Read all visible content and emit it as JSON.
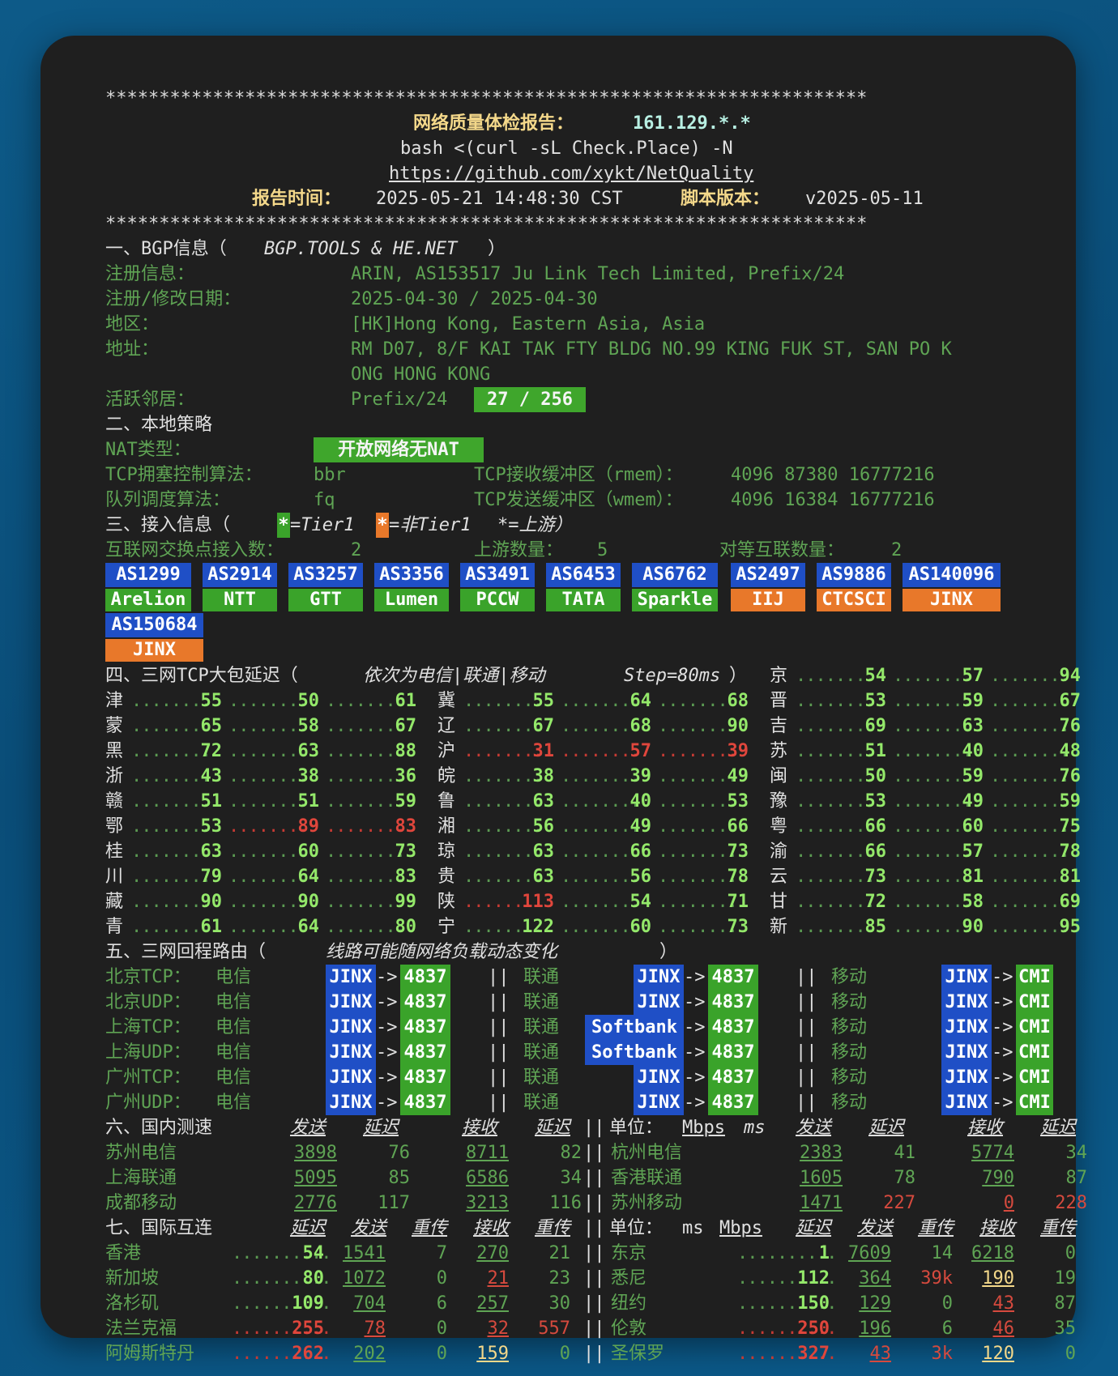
{
  "stars": "***********************************************************************",
  "header": {
    "title": "网络质量体检报告：",
    "ip": "161.129.*.*",
    "cmd": "bash <(curl -sL Check.Place) -N",
    "url": "https://github.com/xykt/NetQuality",
    "time_label": "报告时间：",
    "time_value": "2025-05-21 14:48:30 CST",
    "ver_label": "脚本版本：",
    "ver_value": "v2025-05-11"
  },
  "bgp": {
    "section": "一、BGP信息（",
    "section_src": "BGP.TOOLS & HE.NET",
    "section_end": "）",
    "reg_label": "注册信息：",
    "reg_value": "ARIN, AS153517 Ju Link Tech Limited, Prefix/24",
    "date_label": "注册/修改日期：",
    "date_value": "2025-04-30 / 2025-04-30",
    "region_label": "地区：",
    "region_value": "[HK]Hong Kong, Eastern Asia, Asia",
    "addr_label": "地址：",
    "addr_value1": "RM D07, 8/F KAI TAK FTY BLDG NO.99 KING FUK ST, SAN PO K",
    "addr_value2": "ONG HONG KONG",
    "neigh_label": "活跃邻居：",
    "neigh_prefix": "Prefix/24",
    "neigh_value": "27 / 256"
  },
  "policy": {
    "section": "二、本地策略",
    "nat_label": "NAT类型：",
    "nat_value": "开放网络无NAT",
    "tcp_cc_label": "TCP拥塞控制算法：",
    "tcp_cc_value": "bbr",
    "rmem_label": "TCP接收缓冲区（rmem）：",
    "rmem_value": "4096 87380 16777216",
    "qdisc_label": "队列调度算法：",
    "qdisc_value": "fq",
    "wmem_label": "TCP发送缓冲区（wmem）：",
    "wmem_value": "4096 16384 16777216"
  },
  "access": {
    "section": "三、接入信息（",
    "legend_star": "*",
    "legend_t1": "=Tier1",
    "legend_nt1": "=非Tier1",
    "legend_up": "*=上游）",
    "ix_label": "互联网交换点接入数：",
    "ix_value": "2",
    "up_label": "上游数量：",
    "up_value": "5",
    "peer_label": "对等互联数量：",
    "peer_value": "2",
    "asns": [
      {
        "as": "AS1299",
        "name": "Arelion",
        "color": "#3aa32a"
      },
      {
        "as": "AS2914",
        "name": "NTT",
        "color": "#3aa32a"
      },
      {
        "as": "AS3257",
        "name": "GTT",
        "color": "#3aa32a"
      },
      {
        "as": "AS3356",
        "name": "Lumen",
        "color": "#3aa32a"
      },
      {
        "as": "AS3491",
        "name": "PCCW",
        "color": "#3aa32a"
      },
      {
        "as": "AS6453",
        "name": "TATA",
        "color": "#3aa32a"
      },
      {
        "as": "AS6762",
        "name": "Sparkle",
        "color": "#3aa32a"
      },
      {
        "as": "AS2497",
        "name": "IIJ",
        "color": "#e8782a"
      },
      {
        "as": "AS9886",
        "name": "CTCSCI",
        "color": "#e8782a"
      },
      {
        "as": "AS140096",
        "name": "JINX",
        "color": "#e8782a"
      },
      {
        "as": "AS150684",
        "name": "JINX",
        "color": "#e8782a"
      }
    ]
  },
  "latency": {
    "section_a": "四、三网TCP大包延迟（",
    "section_b": "依次为电信|联通|移动",
    "section_c": "Step=80ms",
    "section_d": "）",
    "rows": [
      [
        null,
        {
          "p": "京",
          "v": [
            "54",
            "57",
            "94"
          ]
        }
      ],
      [
        {
          "p": "津",
          "v": [
            "55",
            "50",
            "61"
          ]
        },
        {
          "p": "冀",
          "v": [
            "55",
            "64",
            "68"
          ]
        },
        {
          "p": "晋",
          "v": [
            "53",
            "59",
            "67"
          ]
        }
      ],
      [
        {
          "p": "蒙",
          "v": [
            "65",
            "58",
            "67"
          ]
        },
        {
          "p": "辽",
          "v": [
            "67",
            "68",
            "90"
          ]
        },
        {
          "p": "吉",
          "v": [
            "69",
            "63",
            "76"
          ]
        }
      ],
      [
        {
          "p": "黑",
          "v": [
            "72",
            "63",
            "88"
          ]
        },
        {
          "p": "沪",
          "v": [
            "31",
            "57",
            "39"
          ],
          "red": [
            true,
            true,
            true
          ]
        },
        {
          "p": "苏",
          "v": [
            "51",
            "40",
            "48"
          ]
        }
      ],
      [
        {
          "p": "浙",
          "v": [
            "43",
            "38",
            "36"
          ]
        },
        {
          "p": "皖",
          "v": [
            "38",
            "39",
            "49"
          ]
        },
        {
          "p": "闽",
          "v": [
            "50",
            "59",
            "76"
          ]
        }
      ],
      [
        {
          "p": "赣",
          "v": [
            "51",
            "51",
            "59"
          ]
        },
        {
          "p": "鲁",
          "v": [
            "63",
            "40",
            "53"
          ]
        },
        {
          "p": "豫",
          "v": [
            "53",
            "49",
            "59"
          ]
        }
      ],
      [
        {
          "p": "鄂",
          "v": [
            "53",
            "89",
            "83"
          ],
          "red": [
            false,
            true,
            true
          ]
        },
        {
          "p": "湘",
          "v": [
            "56",
            "49",
            "66"
          ]
        },
        {
          "p": "粤",
          "v": [
            "66",
            "60",
            "75"
          ]
        }
      ],
      [
        {
          "p": "桂",
          "v": [
            "63",
            "60",
            "73"
          ]
        },
        {
          "p": "琼",
          "v": [
            "63",
            "66",
            "73"
          ]
        },
        {
          "p": "渝",
          "v": [
            "66",
            "57",
            "78"
          ]
        }
      ],
      [
        {
          "p": "川",
          "v": [
            "79",
            "64",
            "83"
          ]
        },
        {
          "p": "贵",
          "v": [
            "63",
            "56",
            "78"
          ]
        },
        {
          "p": "云",
          "v": [
            "73",
            "81",
            "81"
          ]
        }
      ],
      [
        {
          "p": "藏",
          "v": [
            "90",
            "90",
            "99"
          ]
        },
        {
          "p": "陕",
          "v": [
            "113",
            "54",
            "71"
          ],
          "red": [
            true,
            false,
            false
          ]
        },
        {
          "p": "甘",
          "v": [
            "72",
            "58",
            "69"
          ]
        }
      ],
      [
        {
          "p": "青",
          "v": [
            "61",
            "64",
            "80"
          ]
        },
        {
          "p": "宁",
          "v": [
            "122",
            "60",
            "73"
          ]
        },
        {
          "p": "新",
          "v": [
            "85",
            "90",
            "95"
          ]
        }
      ]
    ]
  },
  "routes": {
    "section_a": "五、三网回程路由（",
    "section_b": "线路可能随网络负载动态变化",
    "section_c": "）",
    "ct": "电信",
    "cu": "联通",
    "cm": "移动",
    "sep": "||",
    "arrow": "->",
    "rows": [
      {
        "city": "北京TCP：",
        "ct": [
          "JINX",
          "4837"
        ],
        "cu": [
          "JINX",
          "4837"
        ],
        "cm": [
          "JINX",
          "CMI"
        ]
      },
      {
        "city": "北京UDP：",
        "ct": [
          "JINX",
          "4837"
        ],
        "cu": [
          "JINX",
          "4837"
        ],
        "cm": [
          "JINX",
          "CMI"
        ]
      },
      {
        "city": "上海TCP：",
        "ct": [
          "JINX",
          "4837"
        ],
        "cu": [
          "Softbank",
          "4837"
        ],
        "cm": [
          "JINX",
          "CMI"
        ]
      },
      {
        "city": "上海UDP：",
        "ct": [
          "JINX",
          "4837"
        ],
        "cu": [
          "Softbank",
          "4837"
        ],
        "cm": [
          "JINX",
          "CMI"
        ]
      },
      {
        "city": "广州TCP：",
        "ct": [
          "JINX",
          "4837"
        ],
        "cu": [
          "JINX",
          "4837"
        ],
        "cm": [
          "JINX",
          "CMI"
        ]
      },
      {
        "city": "广州UDP：",
        "ct": [
          "JINX",
          "4837"
        ],
        "cu": [
          "JINX",
          "4837"
        ],
        "cm": [
          "JINX",
          "CMI"
        ]
      }
    ]
  },
  "domestic": {
    "section": "六、国内测速",
    "h_send": "发送",
    "h_lat": "延迟",
    "h_recv": "接收",
    "unit_label": "单位：",
    "unit_mbps": "Mbps",
    "unit_ms": "ms",
    "rows": [
      {
        "l": {
          "n": "苏州电信",
          "s": "3898",
          "sl": "76",
          "r": "8711",
          "rl": "82"
        },
        "r": {
          "n": "杭州电信",
          "s": "2383",
          "sl": "41",
          "r": "5774",
          "rl": "34"
        }
      },
      {
        "l": {
          "n": "上海联通",
          "s": "5095",
          "sl": "85",
          "r": "6586",
          "rl": "34"
        },
        "r": {
          "n": "香港联通",
          "s": "1605",
          "sl": "78",
          "r": "790",
          "rl": "87"
        }
      },
      {
        "l": {
          "n": "成都移动",
          "s": "2776",
          "sl": "117",
          "r": "3213",
          "rl": "116"
        },
        "r": {
          "n": "苏州移动",
          "s": "1471",
          "sl": "227",
          "r": "0",
          "rl": "228"
        }
      }
    ]
  },
  "intl": {
    "section": "七、国际互连",
    "h_lat": "延迟",
    "h_send": "发送",
    "h_retr": "重传",
    "h_recv": "接收",
    "unit_label": "单位：",
    "unit_ms": "ms",
    "unit_mbps": "Mbps",
    "rows": [
      {
        "l": {
          "n": "香港",
          "lat": "54",
          "s": "1541",
          "sr": "7",
          "r": "270",
          "rr": "21"
        },
        "r": {
          "n": "东京",
          "lat": "1",
          "s": "7609",
          "sr": "14",
          "r": "6218",
          "rr": "0"
        }
      },
      {
        "l": {
          "n": "新加坡",
          "lat": "80",
          "s": "1072",
          "sr": "0",
          "r": "21",
          "rr": "23"
        },
        "r": {
          "n": "悉尼",
          "lat": "112",
          "s": "364",
          "sr": "39k",
          "r": "190",
          "rr": "19"
        }
      },
      {
        "l": {
          "n": "洛杉矶",
          "lat": "109",
          "s": "704",
          "sr": "6",
          "r": "257",
          "rr": "30"
        },
        "r": {
          "n": "纽约",
          "lat": "150",
          "s": "129",
          "sr": "0",
          "r": "43",
          "rr": "87"
        }
      },
      {
        "l": {
          "n": "法兰克福",
          "lat": "255",
          "s": "78",
          "sr": "0",
          "r": "32",
          "rr": "557"
        },
        "r": {
          "n": "伦敦",
          "lat": "250",
          "s": "196",
          "sr": "6",
          "r": "46",
          "rr": "35"
        }
      },
      {
        "l": {
          "n": "阿姆斯特丹",
          "lat": "262",
          "s": "202",
          "sr": "0",
          "r": "159",
          "rr": "0"
        },
        "r": {
          "n": "圣保罗",
          "lat": "327",
          "s": "43",
          "sr": "3k",
          "r": "120",
          "rr": "0"
        }
      }
    ]
  }
}
